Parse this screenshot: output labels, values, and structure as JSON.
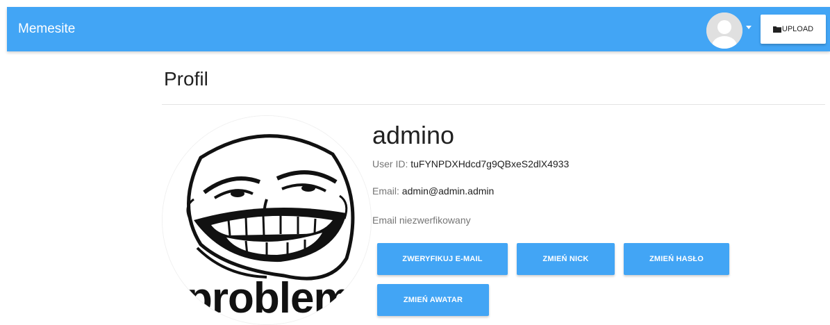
{
  "navbar": {
    "brand": "Memesite",
    "upload_label": "UPLOAD",
    "upload_icon": "folder-icon",
    "user_avatar_icon": "avatar-placeholder-icon",
    "accent_color": "#42a5f5"
  },
  "profile": {
    "page_title": "Profil",
    "username": "admino",
    "user_id_label": "User ID:",
    "user_id_value": "tuFYNPDXHdcd7g9QBxeS2dlX4933",
    "email_label": "Email:",
    "email_value": "admin@admin.admin",
    "email_status": "Email niezwerfikowany",
    "avatar_caption": "problem?"
  },
  "actions": {
    "verify_email": "ZWERYFIKUJ E-MAIL",
    "change_nick": "ZMIEŃ NICK",
    "change_password": "ZMIEŃ HASŁO",
    "change_avatar": "ZMIEŃ AWATAR"
  }
}
